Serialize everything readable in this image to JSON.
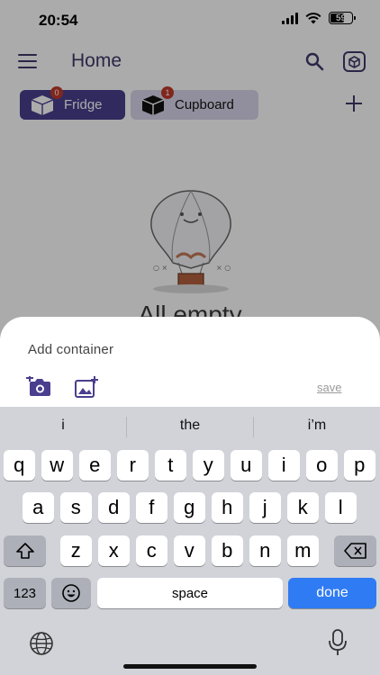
{
  "status_bar": {
    "time": "20:54",
    "battery": "59"
  },
  "app_bar": {
    "title": "Home"
  },
  "chips": [
    {
      "label": "Fridge",
      "badge": "0"
    },
    {
      "label": "Cupboard",
      "badge": "1"
    }
  ],
  "empty_state": {
    "text": "All empty"
  },
  "sheet": {
    "title": "Add container",
    "save_label": "save"
  },
  "keyboard": {
    "suggestions": [
      "i",
      "the",
      "i’m"
    ],
    "row1": [
      "q",
      "w",
      "e",
      "r",
      "t",
      "y",
      "u",
      "i",
      "o",
      "p"
    ],
    "row2": [
      "a",
      "s",
      "d",
      "f",
      "g",
      "h",
      "j",
      "k",
      "l"
    ],
    "row3": [
      "z",
      "x",
      "c",
      "v",
      "b",
      "n",
      "m"
    ],
    "numbers_label": "123",
    "space_label": "space",
    "done_label": "done"
  },
  "colors": {
    "accent": "#4a3f8e",
    "primary_text": "#3f3a6b",
    "badge": "#c0392b",
    "done_key": "#2f7bf3"
  },
  "icons": [
    "hamburger-icon",
    "search-icon",
    "cube-icon",
    "plus-icon",
    "camera-plus-icon",
    "image-plus-icon",
    "shift-icon",
    "backspace-icon",
    "emoji-icon",
    "globe-icon",
    "microphone-icon"
  ]
}
